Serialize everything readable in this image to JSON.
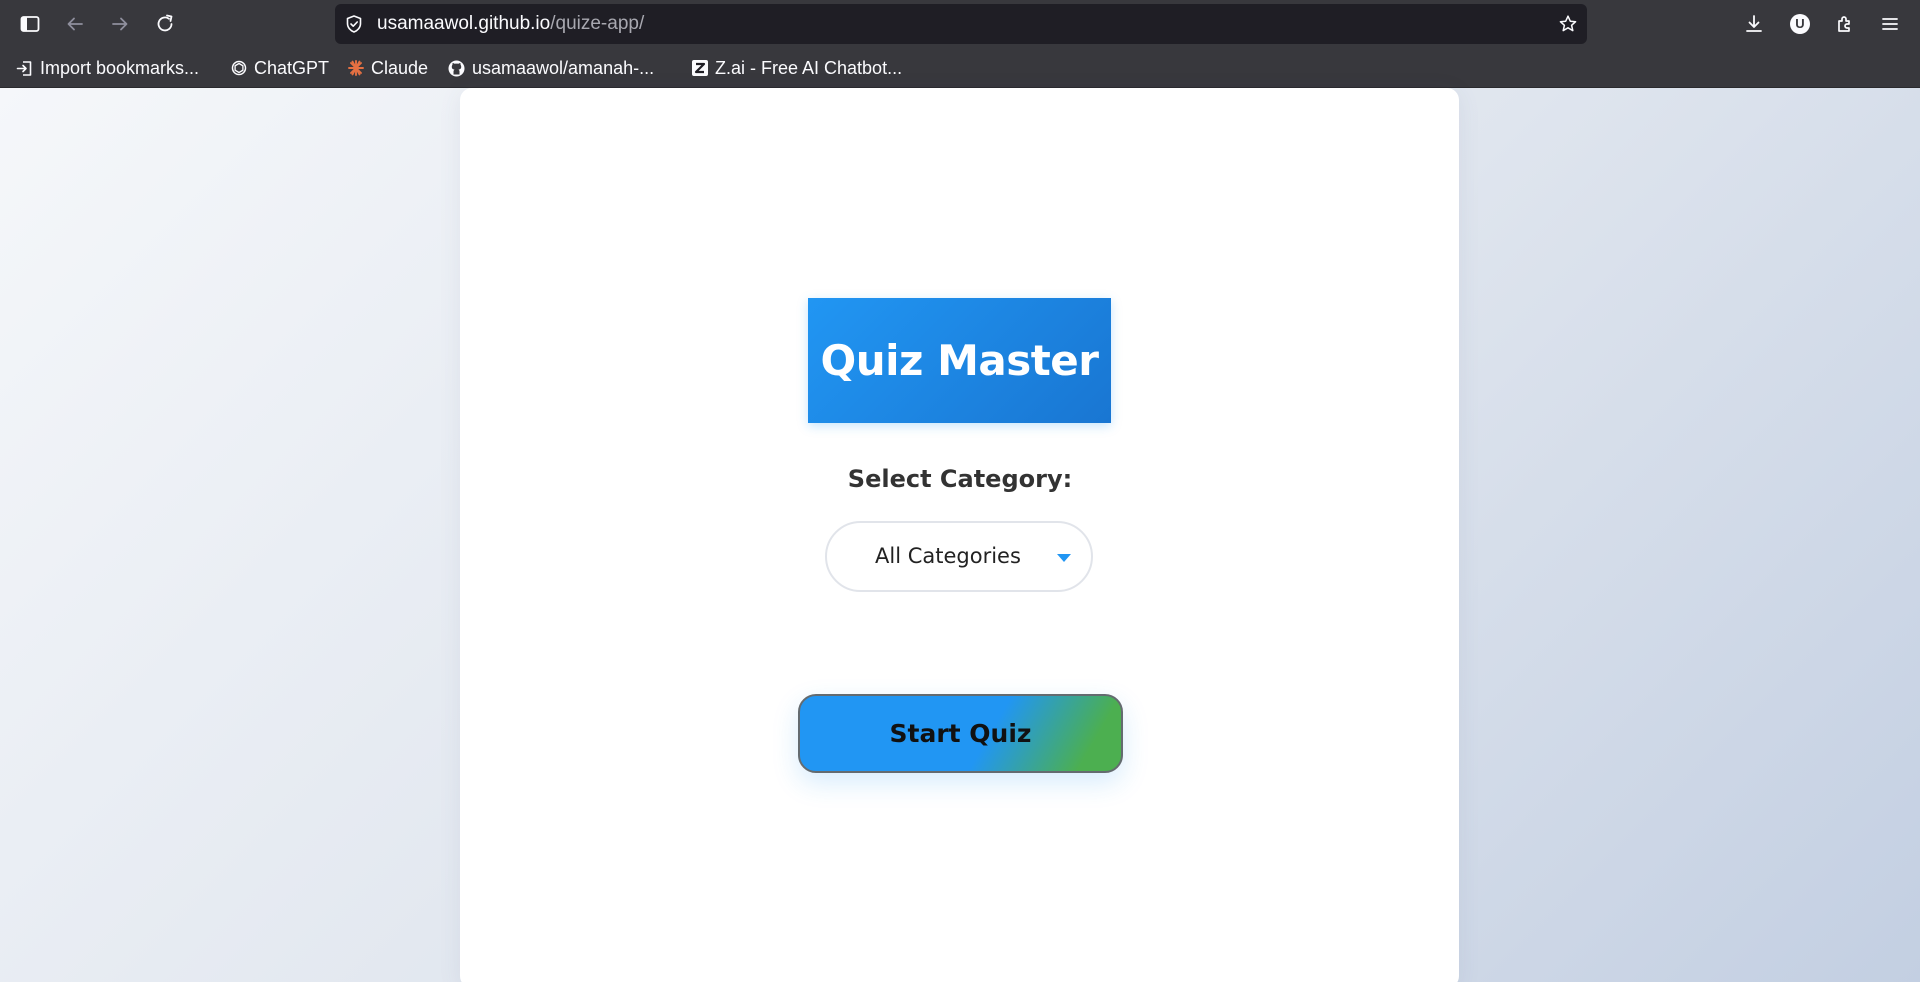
{
  "browser": {
    "url_domain": "usamaawol.github.io",
    "url_path": "/quize-app/",
    "avatar_letter": "U",
    "bookmarks": [
      {
        "label": "Import bookmarks...",
        "icon": "import-icon"
      },
      {
        "label": "ChatGPT",
        "icon": "chatgpt-icon"
      },
      {
        "label": "Claude",
        "icon": "claude-icon"
      },
      {
        "label": "usamaawol/amanah-...",
        "icon": "github-icon"
      },
      {
        "label": "Z.ai - Free AI Chatbot...",
        "icon": "zai-icon"
      }
    ],
    "icons": [
      "sidebar-icon",
      "back-icon",
      "forward-icon",
      "reload-icon",
      "shield-icon",
      "star-icon",
      "download-icon",
      "account-icon",
      "extensions-icon",
      "menu-icon"
    ]
  },
  "quiz": {
    "title": "Quiz Master",
    "category_label": "Select Category:",
    "category_selected": "All Categories",
    "start_button": "Start Quiz"
  },
  "colors": {
    "primary": "#2196f3",
    "secondary": "#4caf50",
    "chrome": "#38383d"
  }
}
